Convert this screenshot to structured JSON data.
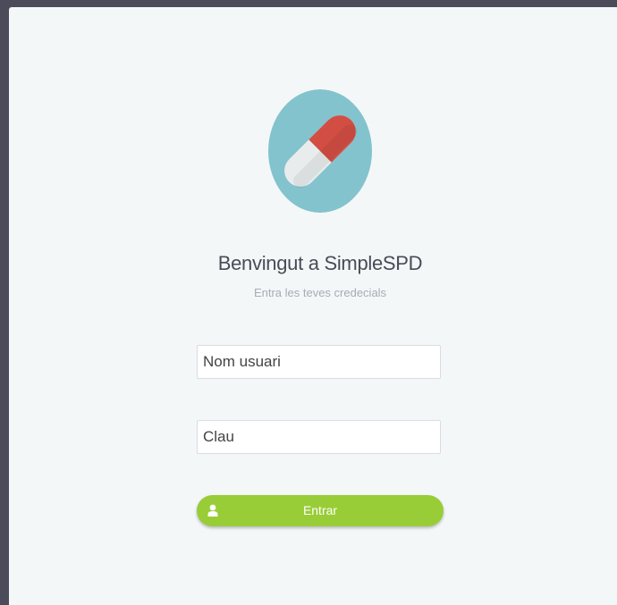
{
  "app": {
    "logo_icon": "pill-capsule-icon",
    "accent_color": "#98cd37",
    "logo_circle_color": "#83c3cd"
  },
  "login": {
    "title": "Benvingut a SimpleSPD",
    "subtitle": "Entra les teves credecials",
    "username_placeholder": "Nom usuari",
    "password_placeholder": "Clau",
    "submit_label": "Entrar",
    "submit_icon": "user-icon"
  }
}
